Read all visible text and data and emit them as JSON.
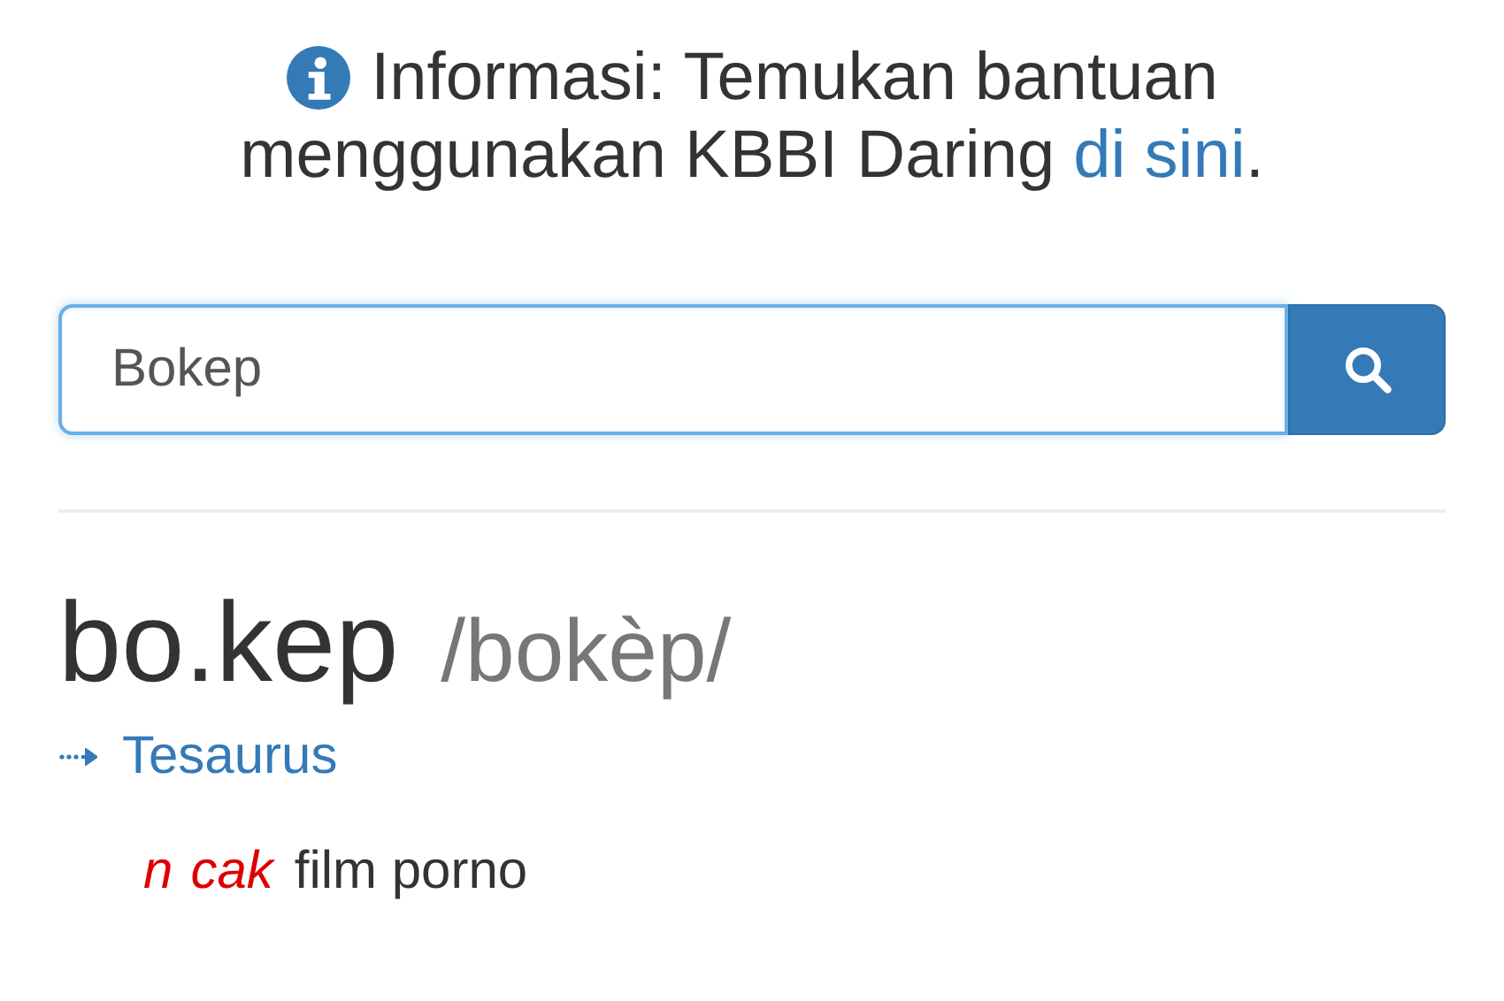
{
  "info": {
    "first_line": "Informasi: Temukan bantuan",
    "text": "menggunakan KBBI Daring ",
    "link": "di sini",
    "end": "."
  },
  "search": {
    "value": "Bokep"
  },
  "entry": {
    "headword": "bo.kep",
    "pronunciation": "/bokèp/",
    "thesaurus_link": "Tesaurus",
    "definitions": [
      {
        "labels": [
          "n",
          "cak"
        ],
        "text": "film porno"
      }
    ]
  }
}
